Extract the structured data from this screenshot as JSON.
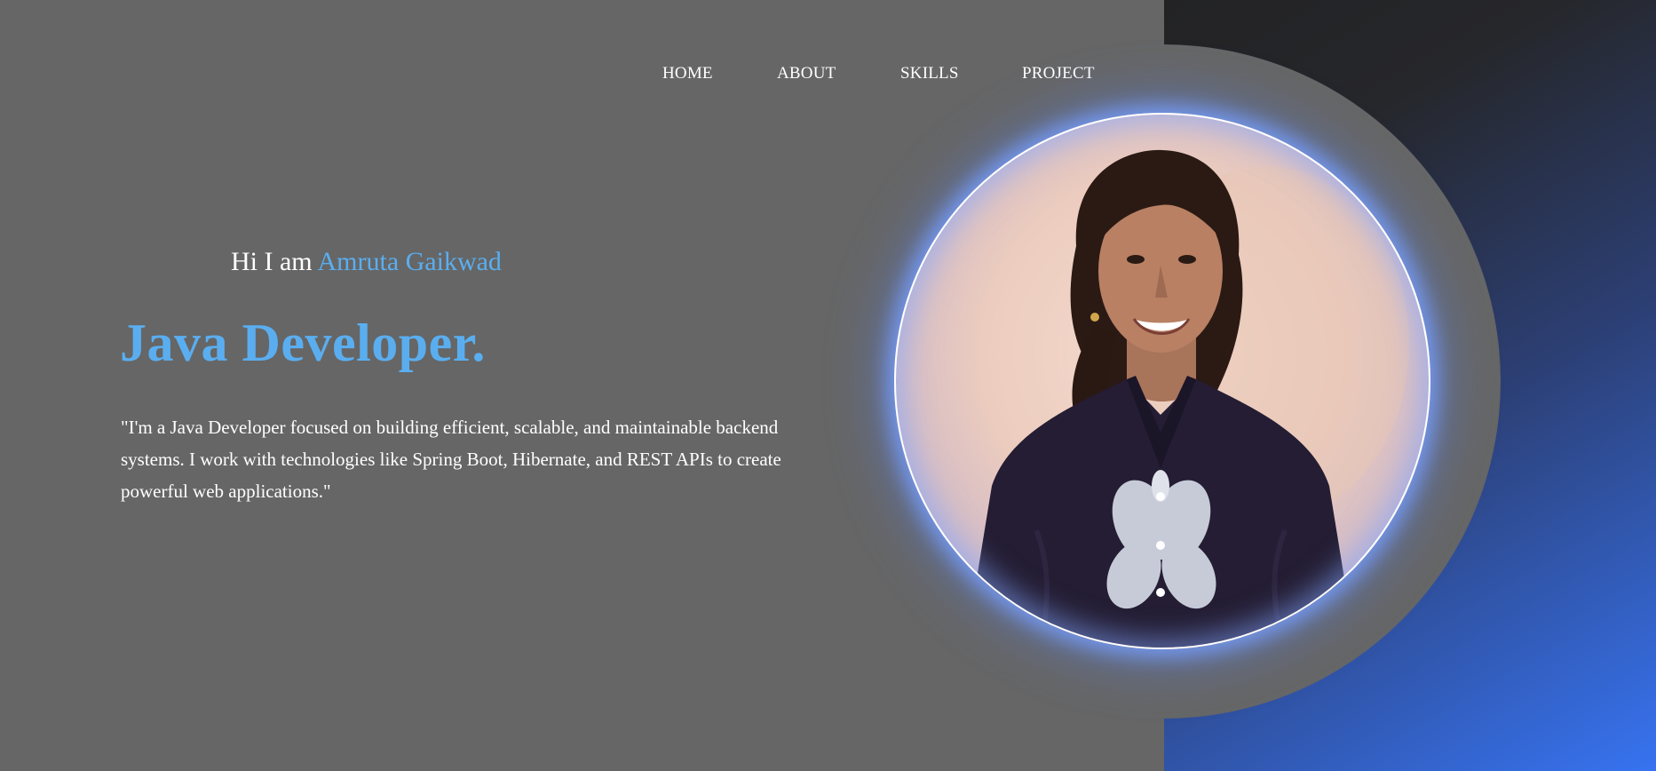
{
  "nav": {
    "items": [
      {
        "label": "HOME"
      },
      {
        "label": "ABOUT"
      },
      {
        "label": "SKILLS"
      },
      {
        "label": "PROJECT"
      }
    ]
  },
  "hero": {
    "greeting_prefix": "Hi I am",
    "name": "Amruta Gaikwad",
    "title": "Java Developer.",
    "bio": "\"I'm a Java Developer focused on building efficient, scalable, and maintainable backend systems. I work with technologies like Spring Boot, Hibernate, and REST APIs to create powerful web applications.\""
  },
  "theme": {
    "page_background": "#666666",
    "accent": "#5aaef0",
    "panel_gradient_start": "#232325",
    "panel_gradient_end": "#3773f1",
    "photo_glow": "#7aa0ff"
  },
  "profile_photo": {
    "icon": "profile-photo"
  }
}
